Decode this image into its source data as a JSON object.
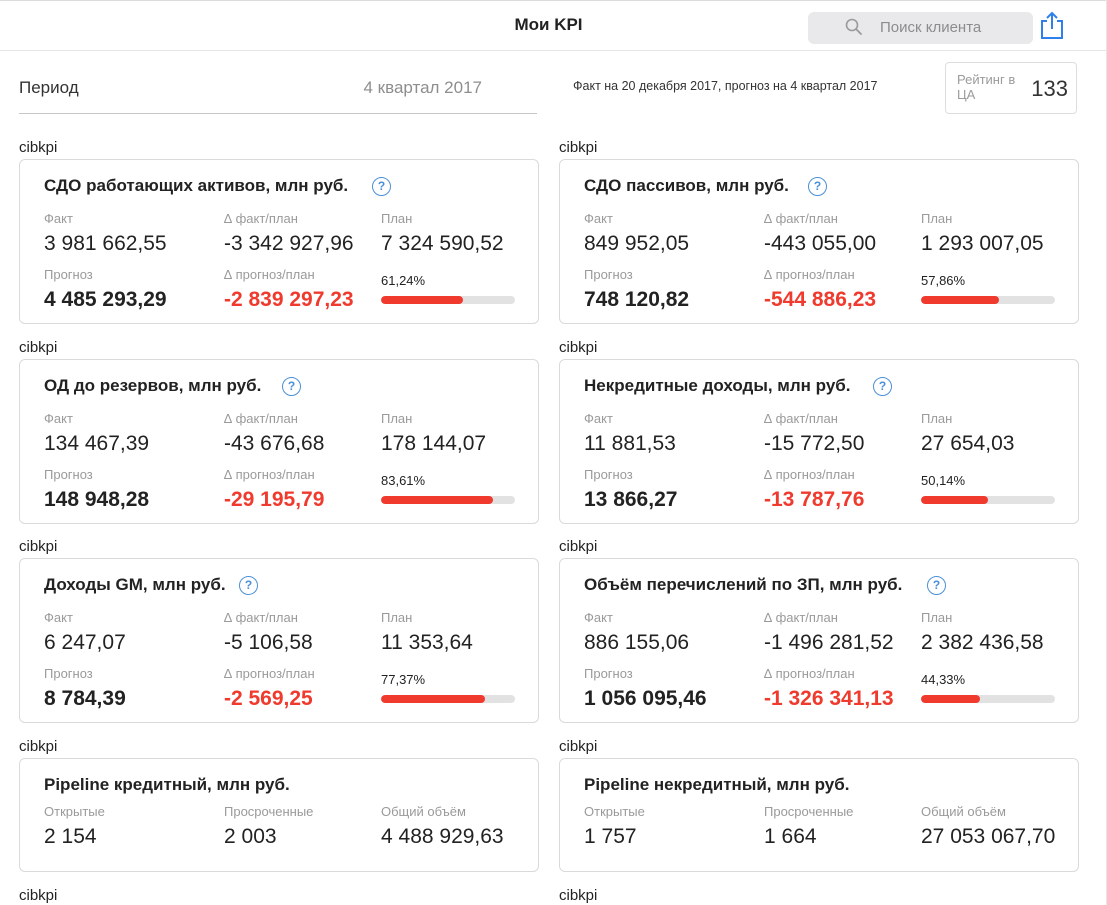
{
  "header": {
    "title": "Мои KPI",
    "search_placeholder": "Поиск клиента"
  },
  "period": {
    "label": "Период",
    "value": "4 квартал 2017"
  },
  "fact_note": "Факт на 20 декабря 2017, прогноз на 4 квартал 2017",
  "rating": {
    "label": "Рейтинг в ЦА",
    "value": "133"
  },
  "labels": {
    "fact": "Факт",
    "delta_fact_plan": "∆ факт/план",
    "plan": "План",
    "forecast": "Прогноз",
    "delta_forecast_plan": "∆ прогноз/план",
    "open": "Открытые",
    "overdue": "Просроченные",
    "total_volume": "Общий объём"
  },
  "kpi_cards": [
    {
      "source": "cibkpi",
      "title": "СДО работающих активов, млн руб.",
      "fact": "3 981 662,55",
      "delta_fact": "-3 342 927,96",
      "plan": "7 324 590,52",
      "forecast": "4 485 293,29",
      "delta_forecast": "-2 839 297,23",
      "percent_label": "61,24%",
      "progress": 0.6124
    },
    {
      "source": "cibkpi",
      "title": "СДО пассивов, млн руб.",
      "fact": "849 952,05",
      "delta_fact": "-443 055,00",
      "plan": "1 293 007,05",
      "forecast": "748 120,82",
      "delta_forecast": "-544 886,23",
      "percent_label": "57,86%",
      "progress": 0.5786
    },
    {
      "source": "cibkpi",
      "title": "ОД до резервов, млн руб.",
      "fact": "134 467,39",
      "delta_fact": "-43 676,68",
      "plan": "178 144,07",
      "forecast": "148 948,28",
      "delta_forecast": "-29 195,79",
      "percent_label": "83,61%",
      "progress": 0.8361
    },
    {
      "source": "cibkpi",
      "title": "Некредитные доходы, млн руб.",
      "fact": "11 881,53",
      "delta_fact": "-15 772,50",
      "plan": "27 654,03",
      "forecast": "13 866,27",
      "delta_forecast": "-13 787,76",
      "percent_label": "50,14%",
      "progress": 0.5014
    },
    {
      "source": "cibkpi",
      "title": "Доходы GM, млн руб.",
      "fact": "6 247,07",
      "delta_fact": "-5 106,58",
      "plan": "11 353,64",
      "forecast": "8 784,39",
      "delta_forecast": "-2 569,25",
      "percent_label": "77,37%",
      "progress": 0.7737
    },
    {
      "source": "cibkpi",
      "title": "Объём перечислений по ЗП, млн руб.",
      "fact": "886 155,06",
      "delta_fact": "-1 496 281,52",
      "plan": "2 382 436,58",
      "forecast": "1 056 095,46",
      "delta_forecast": "-1 326 341,13",
      "percent_label": "44,33%",
      "progress": 0.4433
    }
  ],
  "pipeline_cards": [
    {
      "source": "cibkpi",
      "title": "Pipeline кредитный, млн руб.",
      "open": "2 154",
      "overdue": "2 003",
      "total": "4 488 929,63"
    },
    {
      "source": "cibkpi",
      "title": "Pipeline некредитный, млн руб.",
      "open": "1 757",
      "overdue": "1 664",
      "total": "27 053 067,70"
    }
  ],
  "bottom_sources": [
    "cibkpi",
    "cibkpi"
  ],
  "colors": {
    "accent_red": "#ef3a2d",
    "help_blue": "#4a90d9",
    "share_blue": "#2f80ed"
  }
}
